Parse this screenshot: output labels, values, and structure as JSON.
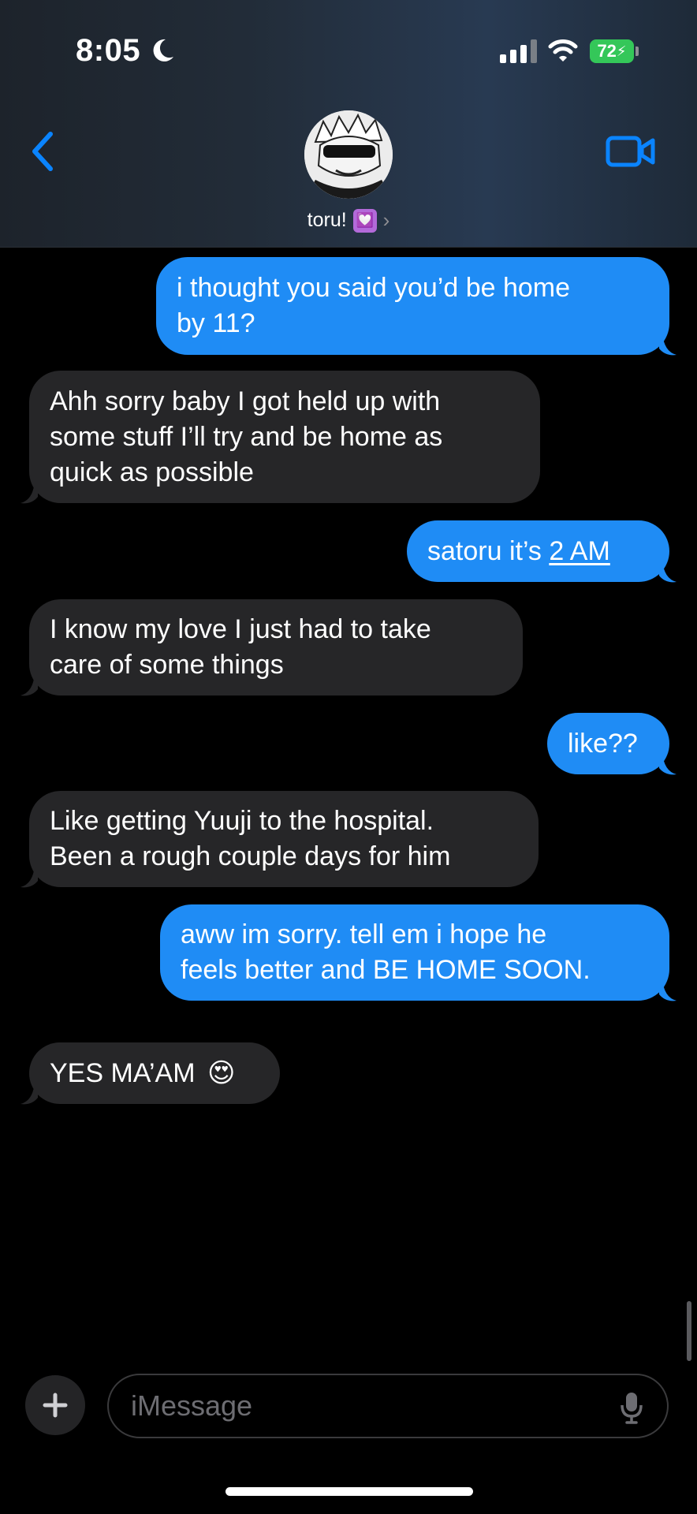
{
  "status_bar": {
    "time": "8:05",
    "battery": "72"
  },
  "header": {
    "contact_name": "toru!",
    "heart_emoji": "💟"
  },
  "messages": [
    {
      "lines": [
        "i thought you said you’d be home",
        "by 11?"
      ]
    },
    {
      "lines": [
        "Ahh sorry baby I got held up with",
        "some stuff I’ll try and be home as",
        "quick as possible"
      ]
    },
    {
      "prefix": "satoru it’s ",
      "link": "2 AM"
    },
    {
      "lines": [
        "I know my love I just had to take",
        "care of some things"
      ]
    },
    {
      "text": "like??"
    },
    {
      "lines": [
        "Like getting Yuuji to the hospital.",
        "Been a rough couple days for him"
      ]
    },
    {
      "lines": [
        "aww im sorry. tell em i hope he",
        "feels better and BE HOME SOON."
      ]
    },
    {
      "text": "YES MA’AM",
      "emoji": "😍"
    }
  ],
  "input": {
    "placeholder": "iMessage"
  },
  "colors": {
    "sent_bubble": "#1f8cf5",
    "received_bubble": "#262628",
    "accent": "#0a84ff",
    "battery": "#34c759"
  },
  "icons": [
    "moon-icon",
    "signal-icon",
    "wifi-icon",
    "battery-icon",
    "back-chevron-icon",
    "video-camera-icon",
    "plus-icon",
    "microphone-icon"
  ]
}
